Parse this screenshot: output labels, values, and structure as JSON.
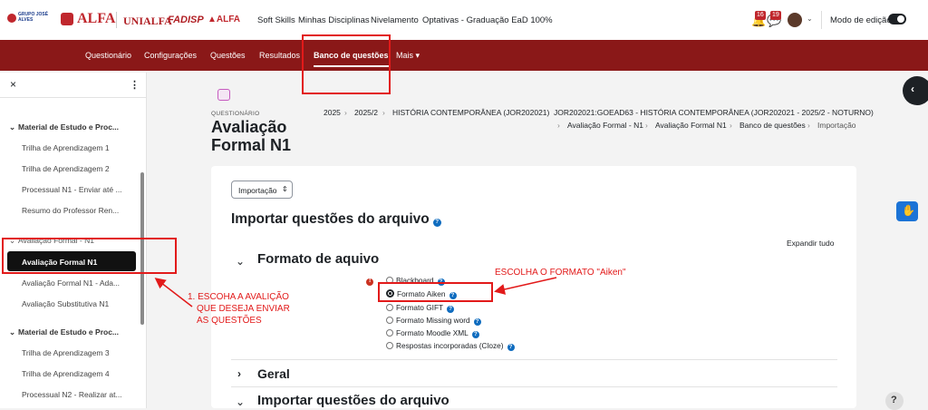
{
  "topbar": {
    "brand_grupo": "GRUPO JOSÉ ALVES",
    "brand_alfa": "ALFA",
    "brand_unialfa": "UNIALFA",
    "brand_fadisp": "FADISP",
    "brand_colegio": "ALFA",
    "nav": [
      "Soft Skills",
      "Minhas Disciplinas",
      "Nivelamento",
      "Optativas - Graduação EaD 100%"
    ],
    "notif_count": "16",
    "msg_count": "19",
    "edit_mode_label": "Modo de edição"
  },
  "secnav": {
    "items": [
      "Questionário",
      "Configurações",
      "Questões",
      "Resultados",
      "Banco de questões",
      "Mais"
    ],
    "active": "Banco de questões"
  },
  "drawer": {
    "close": "×",
    "menu": "⋮",
    "section1": "Material de Estudo e Proc...",
    "items1": [
      "Trilha de Aprendizagem 1",
      "Trilha de Aprendizagem 2",
      "Processual N1 - Enviar até ...",
      "Resumo do Professor Ren..."
    ],
    "section2": "Avaliação Formal - N1",
    "items2": [
      "Avaliação Formal N1",
      "Avaliação Formal N1 - Ada...",
      "Avaliação Substitutiva N1"
    ],
    "section3": "Material de Estudo e Proc...",
    "items3": [
      "Trilha de Aprendizagem 3",
      "Trilha de Aprendizagem 4",
      "Processual N2 - Realizar at..."
    ]
  },
  "page": {
    "kind": "QUESTIONÁRIO",
    "title_line1": "Avaliação",
    "title_line2": "Formal N1",
    "breadcrumb1": [
      "2025",
      "2025/2",
      "HISTÓRIA CONTEMPORÂNEA (JOR202021)",
      "JOR202021:GOEAD63 - HISTÓRIA CONTEMPORÂNEA (JOR202021 - 2025/2 - NOTURNO)"
    ],
    "breadcrumb2": [
      "Avaliação Formal - N1",
      "Avaliação Formal N1",
      "Banco de questões",
      "Importação"
    ],
    "select_value": "Importação",
    "heading": "Importar questões do arquivo",
    "expand_all": "Expandir tudo",
    "section_format": "Formato de aquivo",
    "formats": [
      "Blackboard",
      "Formato Aiken",
      "Formato GIFT",
      "Formato Missing word",
      "Formato Moodle XML",
      "Respostas incorporadas (Cloze)"
    ],
    "section_geral": "Geral",
    "section_import": "Importar questões do arquivo",
    "help_bottom": "?"
  },
  "annotations": {
    "annot_right": "ESCOLHA O FORMATO \"Aiken\"",
    "annot_left_1": "1. ESCOHA A AVALIÇÃO",
    "annot_left_2": "QUE DESEJA ENVIAR",
    "annot_left_3": "AS QUESTÕES"
  },
  "colors": {
    "primary": "#8a1818",
    "link": "#0f6cbf",
    "annotation": "#e21a1a"
  }
}
